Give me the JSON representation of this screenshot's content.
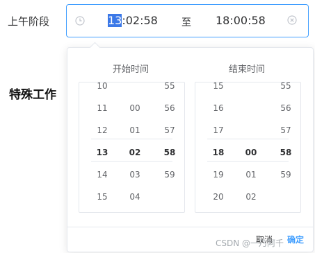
{
  "form": {
    "field_label": "上午阶段",
    "background_label": "特殊工作"
  },
  "range_input": {
    "start_selected": "13",
    "start_rest": ":02:58",
    "separator": "至",
    "end_value": "18:00:58",
    "accent_color": "#409eff"
  },
  "panel": {
    "start_title": "开始时间",
    "end_title": "结束时间",
    "start_columns": {
      "hours": [
        "10",
        "11",
        "12",
        "13",
        "14",
        "15"
      ],
      "minutes": [
        "",
        "00",
        "01",
        "02",
        "03",
        "04"
      ],
      "seconds": [
        "55",
        "56",
        "57",
        "58",
        "59",
        ""
      ],
      "active": {
        "hour": "13",
        "minute": "02",
        "second": "58"
      }
    },
    "end_columns": {
      "hours": [
        "15",
        "16",
        "17",
        "18",
        "19",
        "20"
      ],
      "minutes": [
        "",
        "",
        "",
        "00",
        "01",
        "02"
      ],
      "seconds": [
        "55",
        "56",
        "57",
        "58",
        "59",
        ""
      ],
      "active": {
        "hour": "18",
        "minute": "00",
        "second": "58"
      }
    },
    "cancel_label": "取消",
    "confirm_label": "确定"
  },
  "icons": {
    "clock": "clock-icon",
    "clear": "circle-close-icon"
  },
  "watermark": "CSDN @一乃阿千"
}
